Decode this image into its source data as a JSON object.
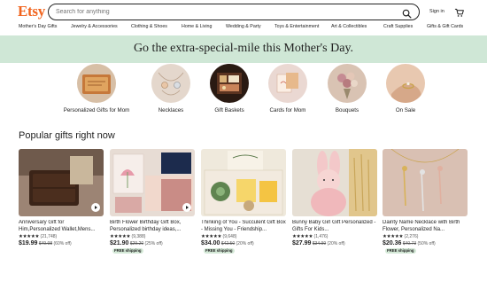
{
  "header": {
    "logo": "Etsy",
    "search_placeholder": "Search for anything",
    "signin_label": "Sign in"
  },
  "nav": [
    "Mother's Day Gifts",
    "Jewelry & Accessories",
    "Clothing & Shoes",
    "Home & Living",
    "Wedding & Party",
    "Toys & Entertainment",
    "Art & Collectibles",
    "Craft Supplies",
    "Gifts & Gift Cards"
  ],
  "banner": {
    "title": "Go the extra-special-mile this Mother's Day."
  },
  "categories": [
    {
      "label": "Personalized Gifts for Mom",
      "icon": "wallet-photo"
    },
    {
      "label": "Necklaces",
      "icon": "necklace-photo"
    },
    {
      "label": "Gift Baskets",
      "icon": "gift-basket-photo"
    },
    {
      "label": "Cards for Mom",
      "icon": "card-photo"
    },
    {
      "label": "Bouquets",
      "icon": "bouquet-photo"
    },
    {
      "label": "On Sale",
      "icon": "ring-photo"
    }
  ],
  "section": {
    "title": "Popular gifts right now"
  },
  "products": [
    {
      "title": "Anniversary Gift for Him,Personalized Wallet,Mens...",
      "stars": "★★★★★",
      "rating_count": "(21,748)",
      "price": "$19.99",
      "original_price": "$49.98",
      "discount": "(60% off)",
      "free_shipping": "",
      "has_video": true
    },
    {
      "title": "Birth Flower Birthday Gift Box, Personalized birthday ideas,...",
      "stars": "★★★★★",
      "rating_count": "(9,388)",
      "price": "$21.90",
      "original_price": "$29.20",
      "discount": "(25% off)",
      "free_shipping": "FREE shipping",
      "has_video": true
    },
    {
      "title": "Thinking of You - Succulent Gift Box - Missing You - Friendship...",
      "stars": "★★★★★",
      "rating_count": "(9,648)",
      "price": "$34.00",
      "original_price": "$42.50",
      "discount": "(20% off)",
      "free_shipping": "FREE shipping",
      "has_video": false
    },
    {
      "title": "Bunny Baby Girl Gift Personalized - Gifts For Kids...",
      "stars": "★★★★★",
      "rating_count": "(1,476)",
      "price": "$27.99",
      "original_price": "$34.99",
      "discount": "(20% off)",
      "free_shipping": "",
      "has_video": false
    },
    {
      "title": "Dainty Name Necklace with Birth Flower, Personalized Na...",
      "stars": "★★★★★",
      "rating_count": "(2,276)",
      "price": "$20.36",
      "original_price": "$40.73",
      "discount": "(50% off)",
      "free_shipping": "FREE shipping",
      "has_video": false
    }
  ],
  "colors": {
    "brand": "#f1641e",
    "banner_bg": "#cfe7d6",
    "free_shipping_bg": "#d4e9d7"
  }
}
